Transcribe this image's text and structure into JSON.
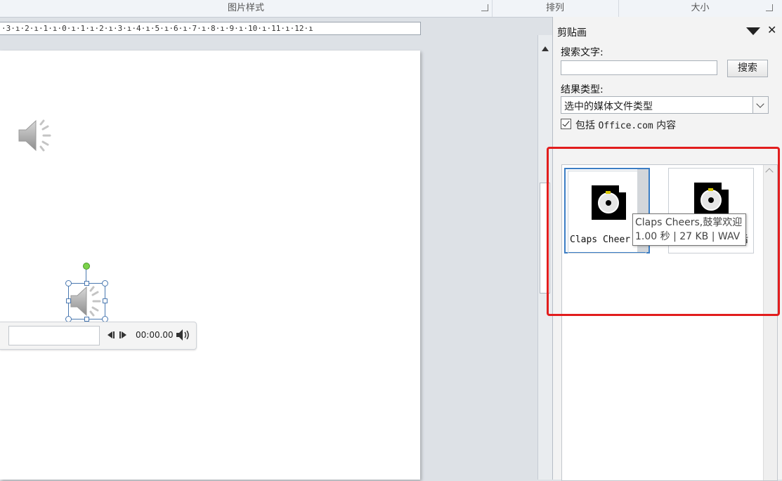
{
  "ribbon": {
    "groups": [
      {
        "label": "图片样式"
      },
      {
        "label": "排列"
      },
      {
        "label": "大小"
      }
    ]
  },
  "ruler": {
    "text": "·3·ı·2·ı·1·ı·0·ı·1·ı·2·ı·3·ı·4·ı·5·ı·6·ı·7·ı·8·ı·9·ı·10·ı·11·ı·12·ı"
  },
  "player": {
    "time": "00:00.00"
  },
  "clip_art_pane": {
    "title": "剪贴画",
    "search_label": "搜索文字:",
    "search_value": "",
    "search_button": "搜索",
    "result_type_label": "结果类型:",
    "result_type_value": "选中的媒体文件类型",
    "include_office_prefix": "包括 ",
    "include_office_mono": "Office.com",
    "include_office_suffix": " 内容",
    "include_office_checked": true,
    "results": [
      {
        "caption": "Claps Cheer",
        "icon": "audio-file-icon"
      },
      {
        "caption": "后",
        "icon": "audio-file-icon"
      }
    ],
    "tooltip": {
      "line1": "Claps Cheers,鼓掌欢迎",
      "line2": "1.00 秒 | 27 KB | WAV"
    }
  },
  "colors": {
    "highlight": "#e21d1d",
    "selection": "#3b7dc4"
  }
}
